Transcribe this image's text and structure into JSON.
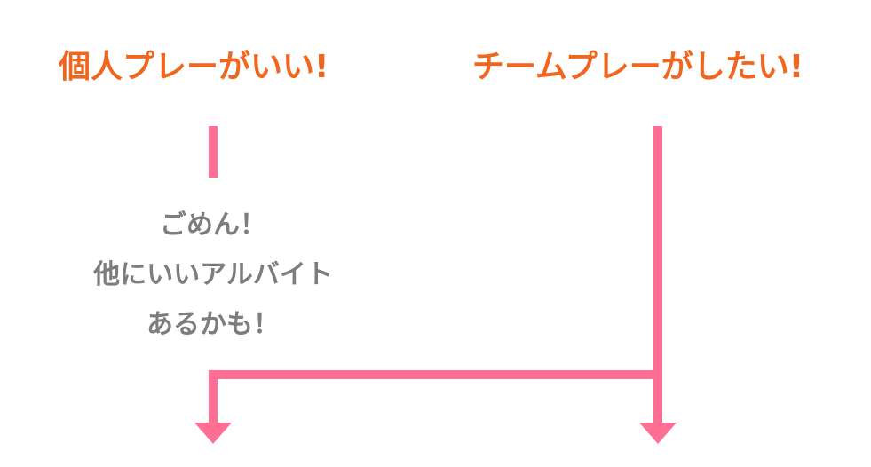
{
  "colors": {
    "heading": "#f0661e",
    "note": "#7d7d7d",
    "line": "#ff6e93"
  },
  "headings": {
    "left": "個人プレーがいい!",
    "right": "チームプレーがしたい!"
  },
  "note": {
    "lines": [
      "ごめん！",
      "他にいいアルバイト",
      "あるかも！"
    ]
  }
}
